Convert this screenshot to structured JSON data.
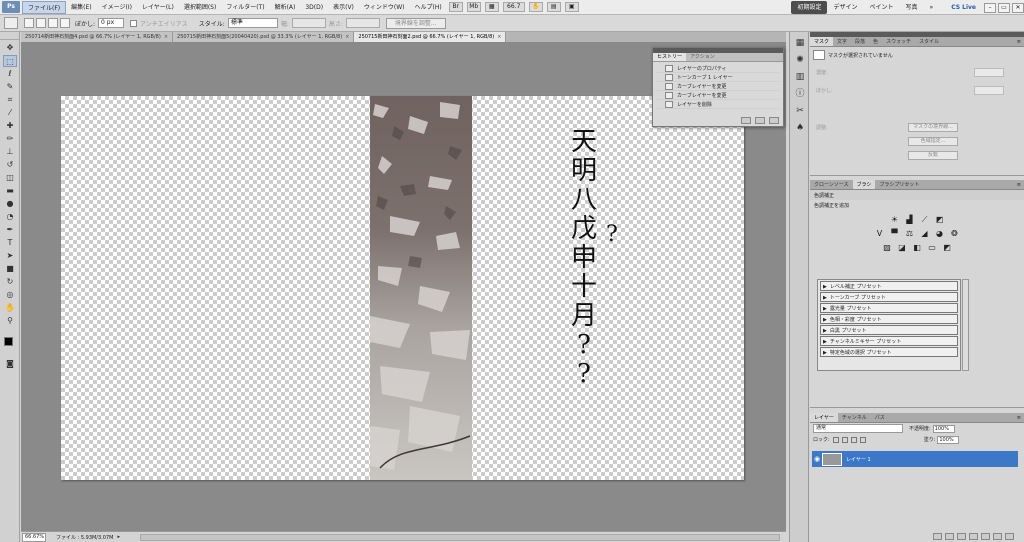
{
  "menubar": {
    "logo": "Ps",
    "menus": [
      "ファイル(F)",
      "編集(E)",
      "イメージ(I)",
      "レイヤー(L)",
      "選択範囲(S)",
      "フィルター(T)",
      "解析(A)",
      "3D(D)",
      "表示(V)",
      "ウィンドウ(W)",
      "ヘルプ(H)"
    ],
    "zoom": "66.7",
    "workspaces": [
      "初期設定",
      "デザイン",
      "ペイント",
      "写真"
    ],
    "more": "»",
    "cs_live": "CS Live"
  },
  "options": {
    "feather_label": "ぼかし:",
    "feather_value": "0 px",
    "antialias_label": "アンチエイリアス",
    "style_label": "スタイル:",
    "style_value": "標準",
    "width_label": "幅:",
    "height_label": "高さ:",
    "refine_button": "境界線を調整..."
  },
  "doc_tabs": [
    {
      "label": "250714新田神石刻面4.psd @ 66.7% (レイヤー 1, RGB/8)",
      "active": false
    },
    {
      "label": "250715新田神石刻面5(20040420).psd @ 33.3% (レイヤー 1, RGB/8)",
      "active": false
    },
    {
      "label": "250715新田神石刻面2.psd @ 66.7% (レイヤー 1, RGB/8)",
      "active": true
    }
  ],
  "canvas": {
    "vertical_text": [
      "天",
      "明",
      "八",
      "戊",
      "申",
      "十",
      "月",
      "?",
      "?"
    ],
    "side_mark": "?"
  },
  "status": {
    "zoom": "66.67%",
    "file_info": "ファイル : 5.93M/3.07M"
  },
  "history": {
    "tabs": [
      "ヒストリー",
      "アクション"
    ],
    "items": [
      "レイヤーのプロパティ",
      "トーンカーブ 1 レイヤー",
      "カーブレイヤーを変更",
      "カーブレイヤーを変更",
      "レイヤーを削除"
    ]
  },
  "mask_panel": {
    "tabs": [
      "マスク",
      "文字",
      "段落",
      "色",
      "スウォッチ",
      "スタイル"
    ],
    "header": "マスクが選択されていません",
    "density_label": "濃度:",
    "feather_label": "ぼかし:",
    "refine_label": "調整:",
    "buttons": [
      "マスクの境界線...",
      "色域指定...",
      "反転"
    ]
  },
  "adjust_panel": {
    "tabs": [
      "クローンソース",
      "ブラシ",
      "ブラシプリセット"
    ],
    "title": "色調補正",
    "subtitle": "色調補正を追加",
    "presets": [
      "レベル補正 プリセット",
      "トーンカーブ プリセット",
      "露光量 プリセット",
      "色相・彩度 プリセット",
      "白黒 プリセット",
      "チャンネルミキサー プリセット",
      "特定色域の選択 プリセット"
    ]
  },
  "layers_panel": {
    "tabs": [
      "レイヤー",
      "チャンネル",
      "パス"
    ],
    "blend_mode": "通常",
    "opacity_label": "不透明度:",
    "opacity": "100%",
    "lock_label": "ロック:",
    "fill_label": "塗り:",
    "fill": "100%",
    "layer_name": "レイヤー 1"
  }
}
